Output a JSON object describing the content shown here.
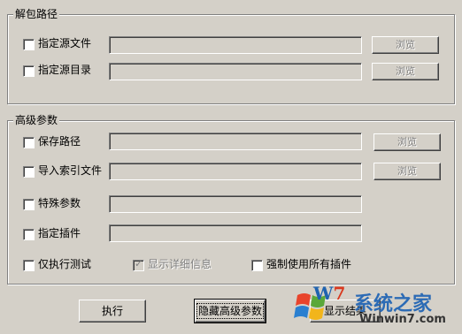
{
  "unpack_group": {
    "title": "解包路径",
    "source_file": {
      "label": "指定源文件",
      "value": "",
      "browse": "浏览"
    },
    "source_dir": {
      "label": "指定源目录",
      "value": "",
      "browse": "浏览"
    }
  },
  "advanced_group": {
    "title": "高级参数",
    "save_path": {
      "label": "保存路径",
      "value": "",
      "browse": "浏览"
    },
    "import_index": {
      "label": "导入索引文件",
      "value": "",
      "browse": "浏览"
    },
    "special_params": {
      "label": "特殊参数",
      "value": ""
    },
    "plugin": {
      "label": "指定插件",
      "value": ""
    },
    "test_only": {
      "label": "仅执行测试",
      "checked": false
    },
    "show_details": {
      "label": "显示详细信息",
      "checked": true,
      "disabled": true
    },
    "force_plugins": {
      "label": "强制使用所有插件",
      "checked": false
    }
  },
  "buttons": {
    "execute": "执行",
    "hide_advanced": "隐藏高级参数",
    "show_result": "显示结果"
  },
  "watermark": {
    "brand": "W",
    "brand_suffix": "7",
    "site_name": "系统之家",
    "url": "Winwin7.com"
  }
}
